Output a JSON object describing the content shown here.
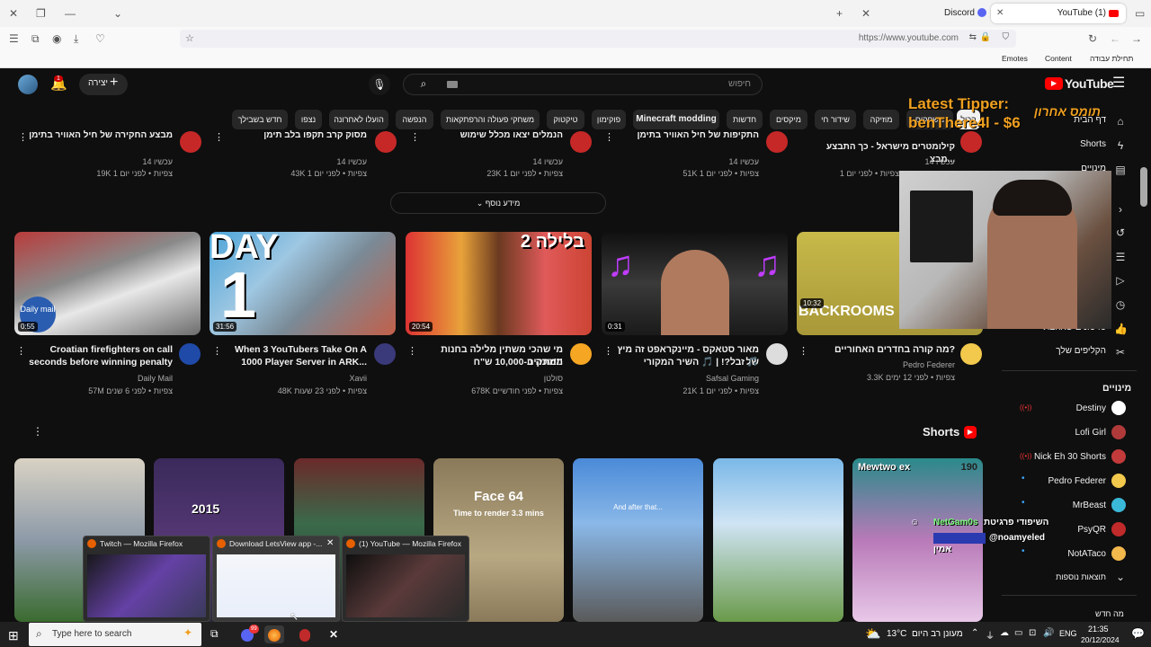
{
  "browser": {
    "tabs": [
      {
        "label": "Discord"
      },
      {
        "label": "YouTube (1)"
      }
    ],
    "url": "https://www.youtube.com",
    "bookmarks": [
      "Emotes",
      "Content",
      "תחילת עבודה"
    ]
  },
  "youtube": {
    "logo": "YouTube",
    "search_placeholder": "חיפוש",
    "create_label": "יצירה",
    "notif_count": "1",
    "chips": [
      "הכול",
      "משחקים",
      "מוזיקה",
      "שידור חי",
      "מיקסים",
      "חדשות",
      "Minecraft modding",
      "פוקימון",
      "טיקטוק",
      "משחקי פעולה והרפתקאות",
      "הנפשה",
      "הועלו לאחרונה",
      "נצפו",
      "חדש בשבילך"
    ],
    "top_row": [
      {
        "title": "מבצע החקירה של חיל האוויר בתימן",
        "channel": "עכשיו 14",
        "meta": "19K צפיות • לפני יום 1"
      },
      {
        "title": "מסוק קרב תקפו בלב תימן",
        "channel": "עכשיו 14",
        "meta": "43K צפיות • לפני יום 1"
      },
      {
        "title": "הנמלים יצאו מכלל שימוש",
        "channel": "עכשיו 14",
        "meta": "23K צפיות • לפני יום 1"
      },
      {
        "title": "התקיפות של חיל האוויר בתימן",
        "channel": "עכשיו 14",
        "meta": "51K צפיות • לפני יום 1"
      },
      {
        "title": "קילומטרים מישראל - כך התבצע מבצ...",
        "channel": "עכשיו 14",
        "meta": "צפיות • לפני יום 1"
      }
    ],
    "more_label": "מידע נוסף",
    "videos": [
      {
        "title1": "Croatian firefighters on call",
        "title2": "seconds before winning penalty",
        "channel": "Daily Mail",
        "meta": "57M צפיות • לפני 6 שנים",
        "duration": "0:55"
      },
      {
        "title1": "When 3 YouTubers Take On A",
        "title2": "1000 Player Server in ARK...",
        "channel": "Xavii",
        "meta": "48K צפיות • לפני 23 שעות",
        "duration": "31:56"
      },
      {
        "title1": "מי שהכי משתין מלילה בחנות ממתקים",
        "title2": "זוכה ב-10,000 ש\"ח!!!",
        "channel": "סולטן",
        "meta": "678K צפיות • לפני חודשיים",
        "duration": "20:54"
      },
      {
        "title1": "מאור סטאקס - מיינקראפט זה מיץ של",
        "title2": "זבל?! | 🎵 השיר המקורי 🎵",
        "channel": "Safsal Gaming",
        "meta": "21K צפיות • לפני יום 1",
        "duration": "0:31"
      },
      {
        "title1": "מה קורה בחדרים האחוריים?",
        "title2": "",
        "channel": "Pedro Federer",
        "meta": "3.3K צפיות • לפני 12 ימים",
        "duration": "10:32"
      }
    ],
    "thumb_texts": {
      "day": "DAY",
      "one": "1",
      "blila": "2 בלילה",
      "backrooms": "BACKROOMS",
      "dailymail": "Daily mail"
    },
    "shorts_title": "Shorts",
    "shorts_texts": [
      "2015",
      "Face 64",
      "Time to render 3.3 mins",
      "And after that...",
      "Mewtwo ex",
      "190"
    ],
    "sidebar": {
      "top": [
        "דף הבית",
        "Shorts",
        "מינויים"
      ],
      "you_items": [
        "הקליפים שלך",
        "סרטונים שאהבתי"
      ],
      "subs_header": "מינויים",
      "subs": [
        "Destiny",
        "Lofi Girl",
        "Nick Eh 30 Shorts",
        "Pedro Federer",
        "MrBeast",
        "PsyQR",
        "NotATaco"
      ],
      "more": "תוצאות נוספות",
      "new_label": "מה חדש"
    }
  },
  "overlay": {
    "tipper_label": "Latest Tipper:",
    "tipper_line": "benThere4l - $6",
    "streamer_tag": "תומס אחרון",
    "chat": [
      {
        "user": "NetGam0s",
        "text": "השיפודי פרגיטת"
      },
      {
        "user": "@noamyeled",
        "text": "אמין"
      }
    ]
  },
  "taskbar": {
    "search_placeholder": "Type here to search",
    "weather": "13°C",
    "weather_text": "מעונן רב היום",
    "lang": "ENG",
    "time": "21:35",
    "date": "20/12/2024",
    "discord_badge": "99",
    "previews": [
      {
        "title": "Twitch — Mozilla Firefox"
      },
      {
        "title": "Download LetsView app -..."
      },
      {
        "title": "(1) YouTube — Mozilla Firefox"
      }
    ]
  }
}
